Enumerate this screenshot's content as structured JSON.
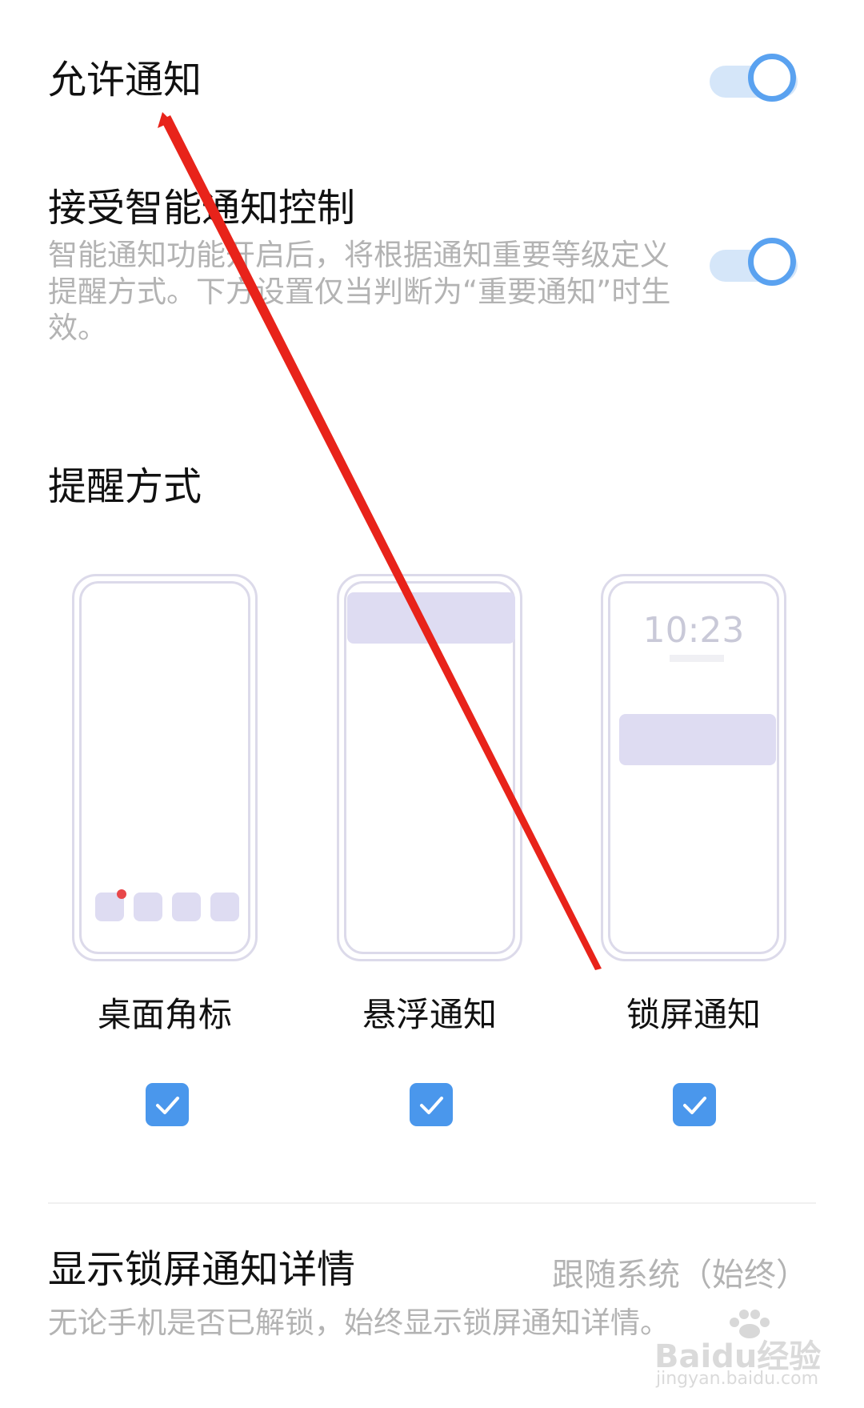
{
  "allow_notifications": {
    "label": "允许通知",
    "enabled": true
  },
  "smart_control": {
    "label": "接受智能通知控制",
    "description": "智能通知功能开启后，将根据通知重要等级定义提醒方式。下方设置仅当判断为“重要通知”时生效。",
    "enabled": true
  },
  "reminder_section": {
    "title": "提醒方式"
  },
  "reminder_options": [
    {
      "label": "桌面角标",
      "checked": true
    },
    {
      "label": "悬浮通知",
      "checked": true
    },
    {
      "label": "锁屏通知",
      "checked": true
    }
  ],
  "lockscreen_preview": {
    "time": "10:23"
  },
  "lockscreen_details": {
    "label": "显示锁屏通知详情",
    "value": "跟随系统（始终）",
    "description": "无论手机是否已解锁，始终显示锁屏通知详情。"
  },
  "watermark": {
    "brand": "Baidu经验",
    "url": "jingyan.baidu.com"
  },
  "colors": {
    "accent": "#4a97ec",
    "toggle_track": "#d5e6f9",
    "annotation_arrow": "#e8231a",
    "badge_dot": "#e8474a"
  }
}
